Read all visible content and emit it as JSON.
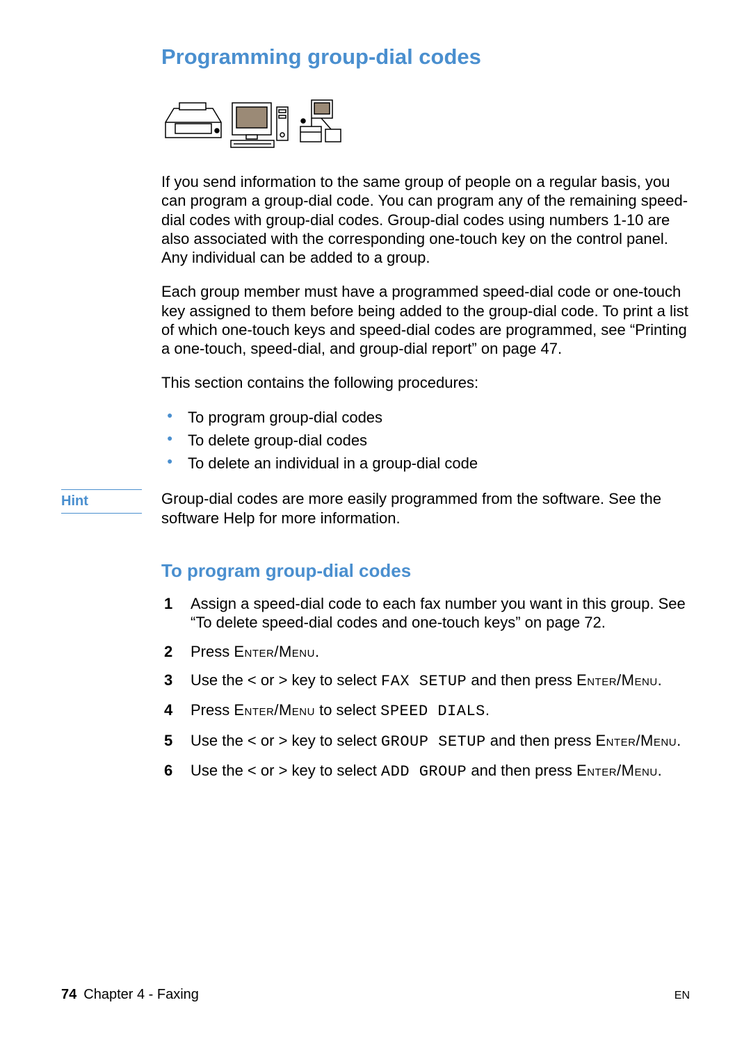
{
  "title": "Programming group-dial codes",
  "intro_p1": "If you send information to the same group of people on a regular basis, you can program a group-dial code. You can program any of the remaining speed-dial codes with group-dial codes. Group-dial codes using numbers 1-10 are also associated with the corresponding one-touch key on the control panel. Any individual can be added to a group.",
  "intro_p2": "Each group member must have a programmed speed-dial code or one-touch key assigned to them before being added to the group-dial code. To print a list of which one-touch keys and speed-dial codes are programmed, see “Printing a one-touch, speed-dial, and group-dial report” on page 47.",
  "procedures_lead": "This section contains the following procedures:",
  "bullets": {
    "b1": "To program group-dial codes",
    "b2": "To delete group-dial codes",
    "b3": "To delete an individual in a group-dial code"
  },
  "hint_label": "Hint",
  "hint_text": "Group-dial codes are more easily programmed from the software. See the software Help for more information.",
  "subheading": "To program group-dial codes",
  "steps": {
    "s1": "Assign a speed-dial code to each fax number you want in this group. See “To delete speed-dial codes and one-touch keys” on page 72.",
    "s2_a": "Press ",
    "s2_key": "Enter/Menu",
    "s2_b": ".",
    "s3_a": "Use the < or > key to select ",
    "s3_lcd": "FAX SETUP",
    "s3_b": " and then press ",
    "s3_key": "Enter/Menu",
    "s3_c": ".",
    "s4_a": "Press ",
    "s4_key": "Enter/Menu",
    "s4_b": " to select ",
    "s4_lcd": "SPEED DIALS",
    "s4_c": ".",
    "s5_a": "Use the < or > key to select ",
    "s5_lcd": "GROUP SETUP",
    "s5_b": " and then press ",
    "s5_key": "Enter/Menu",
    "s5_c": ".",
    "s6_a": "Use the < or > key to select ",
    "s6_lcd": "ADD GROUP",
    "s6_b": " and then press ",
    "s6_key": "Enter/Menu",
    "s6_c": "."
  },
  "footer": {
    "page_number": "74",
    "chapter": "Chapter 4 - Faxing",
    "lang": "EN"
  }
}
